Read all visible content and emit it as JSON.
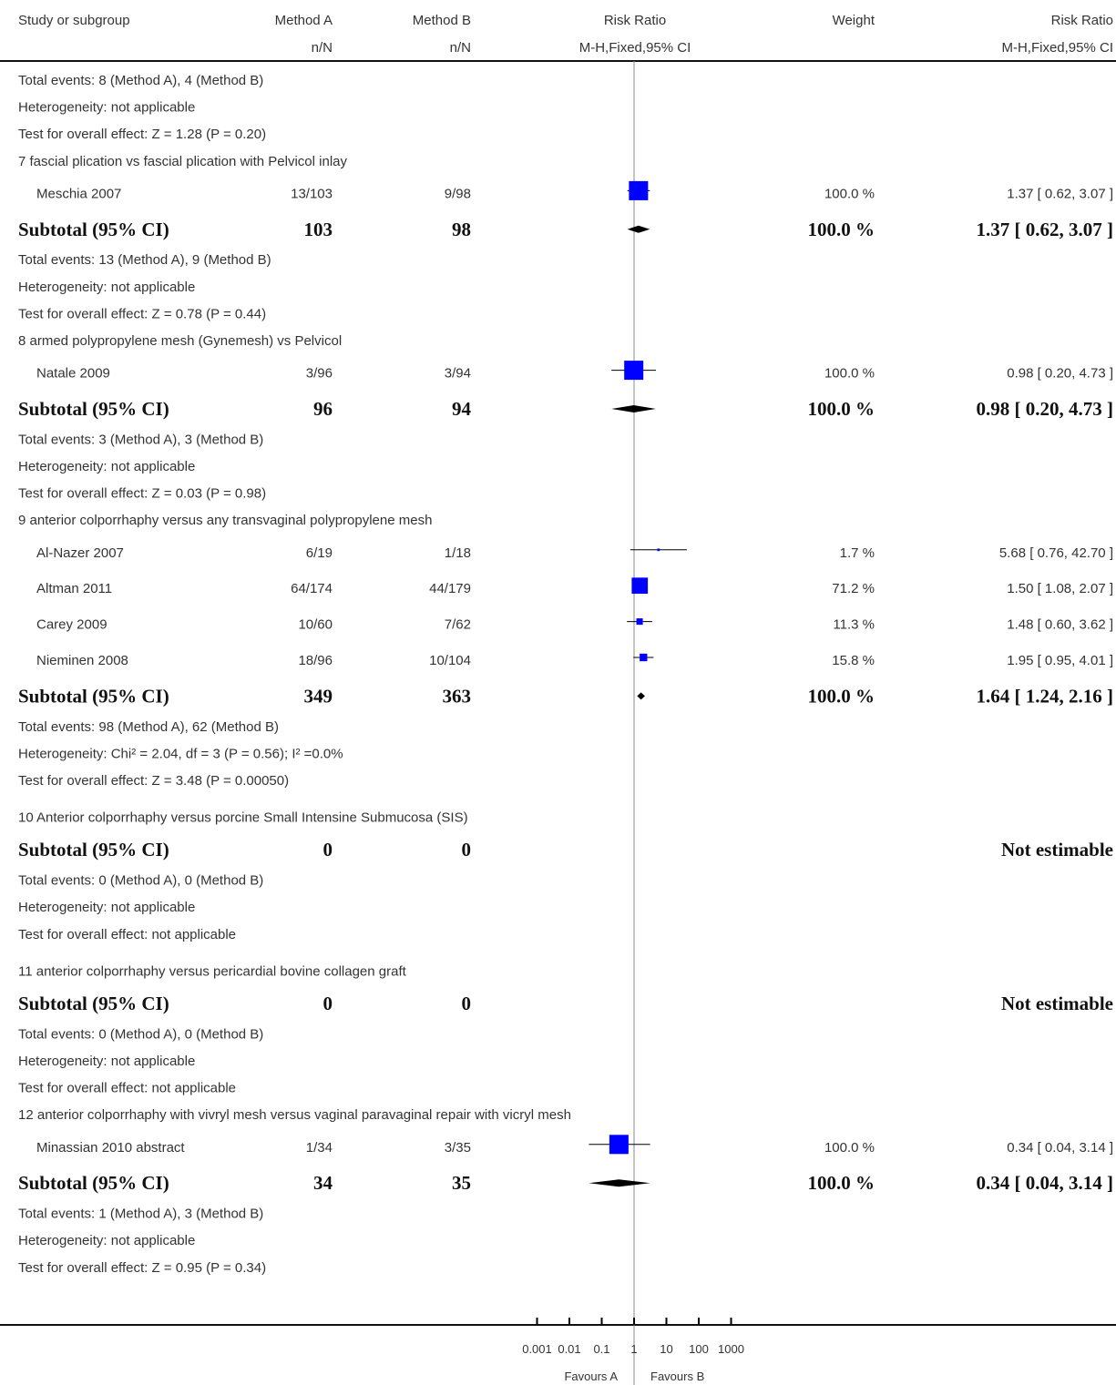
{
  "header": {
    "columns": [
      "Study or subgroup",
      "Method A",
      "Method B",
      "Risk Ratio",
      "Weight",
      "Risk Ratio"
    ],
    "subheaders": [
      "n/N",
      "n/N",
      "M-H,Fixed,95% CI",
      "M-H,Fixed,95% CI"
    ]
  },
  "chart_data": {
    "type": "forest",
    "x_scale": "log",
    "xlim": [
      0.001,
      1000
    ],
    "xticks": [
      "0.001",
      "0.01",
      "0.1",
      "1",
      "10",
      "100",
      "1000"
    ],
    "favours_left": "Favours A",
    "favours_right": "Favours B",
    "rows": [
      {
        "kind": "text",
        "text": "Total events: 8 (Method A), 4 (Method B)"
      },
      {
        "kind": "text",
        "text": "Heterogeneity: not applicable"
      },
      {
        "kind": "text",
        "text": "Test for overall effect: Z = 1.28 (P = 0.20)"
      },
      {
        "kind": "group",
        "text": "7 fascial plication vs fascial plication with Pelvicol inlay"
      },
      {
        "kind": "study",
        "name": "Meschia 2007",
        "a": "13/103",
        "b": "9/98",
        "weight": "100.0 %",
        "ci": "1.37 [ 0.62, 3.07 ]",
        "rr": 1.37,
        "lo": 0.62,
        "hi": 3.07,
        "w": 100
      },
      {
        "kind": "subtotal",
        "name": "Subtotal (95% CI)",
        "a": "103",
        "b": "98",
        "weight": "100.0 %",
        "ci": "1.37 [ 0.62, 3.07 ]",
        "rr": 1.37,
        "lo": 0.62,
        "hi": 3.07
      },
      {
        "kind": "text",
        "text": "Total events: 13 (Method A), 9 (Method B)"
      },
      {
        "kind": "text",
        "text": "Heterogeneity: not applicable"
      },
      {
        "kind": "text",
        "text": "Test for overall effect: Z = 0.78 (P = 0.44)"
      },
      {
        "kind": "group",
        "text": "8 armed polypropylene mesh (Gynemesh) vs Pelvicol"
      },
      {
        "kind": "study",
        "name": "Natale 2009",
        "a": "3/96",
        "b": "3/94",
        "weight": "100.0 %",
        "ci": "0.98 [ 0.20, 4.73 ]",
        "rr": 0.98,
        "lo": 0.2,
        "hi": 4.73,
        "w": 100
      },
      {
        "kind": "subtotal",
        "name": "Subtotal (95% CI)",
        "a": "96",
        "b": "94",
        "weight": "100.0 %",
        "ci": "0.98 [ 0.20, 4.73 ]",
        "rr": 0.98,
        "lo": 0.2,
        "hi": 4.73
      },
      {
        "kind": "text",
        "text": "Total events: 3 (Method A), 3 (Method B)"
      },
      {
        "kind": "text",
        "text": "Heterogeneity: not applicable"
      },
      {
        "kind": "text",
        "text": "Test for overall effect: Z = 0.03 (P = 0.98)"
      },
      {
        "kind": "group",
        "text": "9 anterior colporrhaphy versus any transvaginal polypropylene mesh"
      },
      {
        "kind": "study",
        "name": "Al-Nazer 2007",
        "a": "6/19",
        "b": "1/18",
        "weight": "1.7 %",
        "ci": "5.68 [ 0.76, 42.70 ]",
        "rr": 5.68,
        "lo": 0.76,
        "hi": 42.7,
        "w": 1.7
      },
      {
        "kind": "study",
        "name": "Altman 2011",
        "a": "64/174",
        "b": "44/179",
        "weight": "71.2 %",
        "ci": "1.50 [ 1.08, 2.07 ]",
        "rr": 1.5,
        "lo": 1.08,
        "hi": 2.07,
        "w": 71.2
      },
      {
        "kind": "study",
        "name": "Carey 2009",
        "a": "10/60",
        "b": "7/62",
        "weight": "11.3 %",
        "ci": "1.48 [ 0.60, 3.62 ]",
        "rr": 1.48,
        "lo": 0.6,
        "hi": 3.62,
        "w": 11.3
      },
      {
        "kind": "study",
        "name": "Nieminen 2008",
        "a": "18/96",
        "b": "10/104",
        "weight": "15.8 %",
        "ci": "1.95 [ 0.95, 4.01 ]",
        "rr": 1.95,
        "lo": 0.95,
        "hi": 4.01,
        "w": 15.8
      },
      {
        "kind": "subtotal",
        "name": "Subtotal (95% CI)",
        "a": "349",
        "b": "363",
        "weight": "100.0 %",
        "ci": "1.64 [ 1.24, 2.16 ]",
        "rr": 1.64,
        "lo": 1.24,
        "hi": 2.16
      },
      {
        "kind": "text",
        "text": "Total events: 98 (Method A), 62 (Method B)"
      },
      {
        "kind": "text",
        "text": "Heterogeneity: Chi² = 2.04, df = 3 (P = 0.56); I² =0.0%"
      },
      {
        "kind": "text",
        "text": "Test for overall effect: Z = 3.48 (P = 0.00050)"
      },
      {
        "kind": "group",
        "text": "10 Anterior colporrhaphy versus porcine Small Intensine Submucosa (SIS)"
      },
      {
        "kind": "subtotal",
        "name": "Subtotal (95% CI)",
        "a": "0",
        "b": "0",
        "weight": "",
        "ci": "Not estimable"
      },
      {
        "kind": "text",
        "text": "Total events: 0 (Method A), 0 (Method B)"
      },
      {
        "kind": "text",
        "text": "Heterogeneity: not applicable"
      },
      {
        "kind": "text",
        "text": "Test for overall effect: not applicable"
      },
      {
        "kind": "group",
        "text": "11 anterior colporrhaphy versus pericardial bovine collagen graft"
      },
      {
        "kind": "subtotal",
        "name": "Subtotal (95% CI)",
        "a": "0",
        "b": "0",
        "weight": "",
        "ci": "Not estimable"
      },
      {
        "kind": "text",
        "text": "Total events: 0 (Method A), 0 (Method B)"
      },
      {
        "kind": "text",
        "text": "Heterogeneity: not applicable"
      },
      {
        "kind": "text",
        "text": "Test for overall effect: not applicable"
      },
      {
        "kind": "group",
        "text": "12 anterior colporrhaphy with vivryl mesh versus vaginal paravaginal repair with vicryl mesh"
      },
      {
        "kind": "study",
        "name": "Minassian 2010 abstract",
        "a": "1/34",
        "b": "3/35",
        "weight": "100.0 %",
        "ci": "0.34 [ 0.04, 3.14 ]",
        "rr": 0.34,
        "lo": 0.04,
        "hi": 3.14,
        "w": 100
      },
      {
        "kind": "subtotal",
        "name": "Subtotal (95% CI)",
        "a": "34",
        "b": "35",
        "weight": "100.0 %",
        "ci": "0.34 [ 0.04, 3.14 ]",
        "rr": 0.34,
        "lo": 0.04,
        "hi": 3.14
      },
      {
        "kind": "text",
        "text": "Total events: 1 (Method A), 3 (Method B)"
      },
      {
        "kind": "text",
        "text": "Heterogeneity: not applicable"
      },
      {
        "kind": "text",
        "text": "Test for overall effect: Z = 0.95 (P = 0.34)"
      }
    ]
  }
}
